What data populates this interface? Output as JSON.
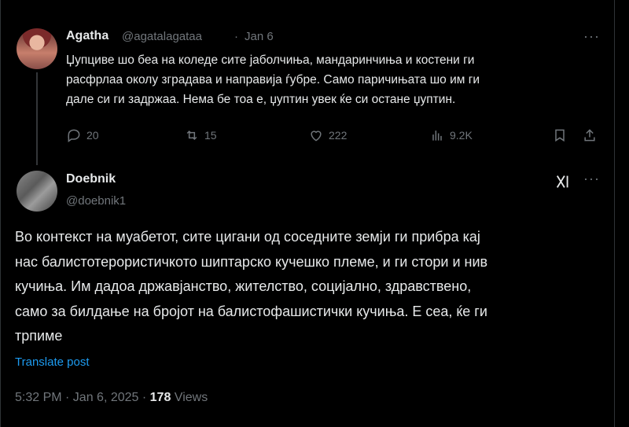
{
  "parent_tweet": {
    "author_name": "Agatha",
    "author_handle": "@agatalagataa",
    "separator": "·",
    "date": "Jan 6",
    "more": "···",
    "text_lines": [
      "Џупциве шо беа на коледе сите јаболчиња, мандаринчиња и костени ги",
      "расфрлаа околу зградава и направија ѓубре. Само паричињата шо им ги",
      "дале  си ги задржаа. Нема бе тоа е, џуптин увек ќе си остане џуптин."
    ],
    "actions": {
      "replies": "20",
      "reposts": "15",
      "likes": "222",
      "views": "9.2K"
    }
  },
  "main_tweet": {
    "author_name": "Doebnik",
    "author_handle": "@doebnik1",
    "more": "···",
    "text_lines": [
      "Во контекст на муабетот, сите цигани од соседните земји ги прибра кај",
      "нас балистотерористичкото шиптарско кучешко племе, и ги стори и нив",
      "кучиња. Им дадоа државјанство, жителство, социјално, здравствено,",
      "само за билдање на бројот на балистофашистички кучиња. Е сеа, ќе ги",
      "трпиме"
    ],
    "translate_label": "Translate post",
    "time": "5:32 PM · Jan 6, 2025 · ",
    "views_count": "178",
    "views_label": " Views"
  },
  "colors": {
    "background": "#000000",
    "text": "#e7e9ea",
    "muted": "#71767b",
    "link": "#1d9bf0"
  }
}
